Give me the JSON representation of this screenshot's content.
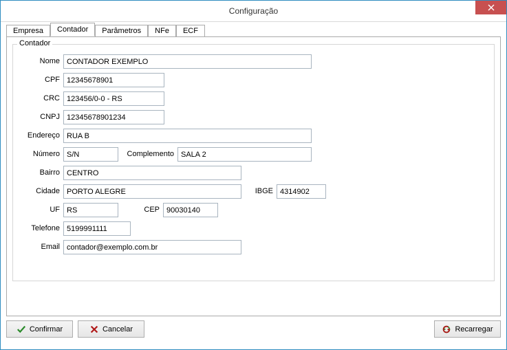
{
  "window": {
    "title": "Configuração"
  },
  "tabs": {
    "empresa": "Empresa",
    "contador": "Contador",
    "parametros": "Parâmetros",
    "nfe": "NFe",
    "ecf": "ECF"
  },
  "groupbox": {
    "title": "Contador"
  },
  "labels": {
    "nome": "Nome",
    "cpf": "CPF",
    "crc": "CRC",
    "cnpj": "CNPJ",
    "endereco": "Endereço",
    "numero": "Número",
    "complemento": "Complemento",
    "bairro": "Bairro",
    "cidade": "Cidade",
    "ibge": "IBGE",
    "uf": "UF",
    "cep": "CEP",
    "telefone": "Telefone",
    "email": "Email"
  },
  "fields": {
    "nome": "CONTADOR EXEMPLO",
    "cpf": "12345678901",
    "crc": "123456/0-0 - RS",
    "cnpj": "12345678901234",
    "endereco": "RUA B",
    "numero": "S/N",
    "complemento": "SALA 2",
    "bairro": "CENTRO",
    "cidade": "PORTO ALEGRE",
    "ibge": "4314902",
    "uf": "RS",
    "cep": "90030140",
    "telefone": "5199991111",
    "email": "contador@exemplo.com.br"
  },
  "buttons": {
    "confirmar": "Confirmar",
    "cancelar": "Cancelar",
    "recarregar": "Recarregar"
  }
}
